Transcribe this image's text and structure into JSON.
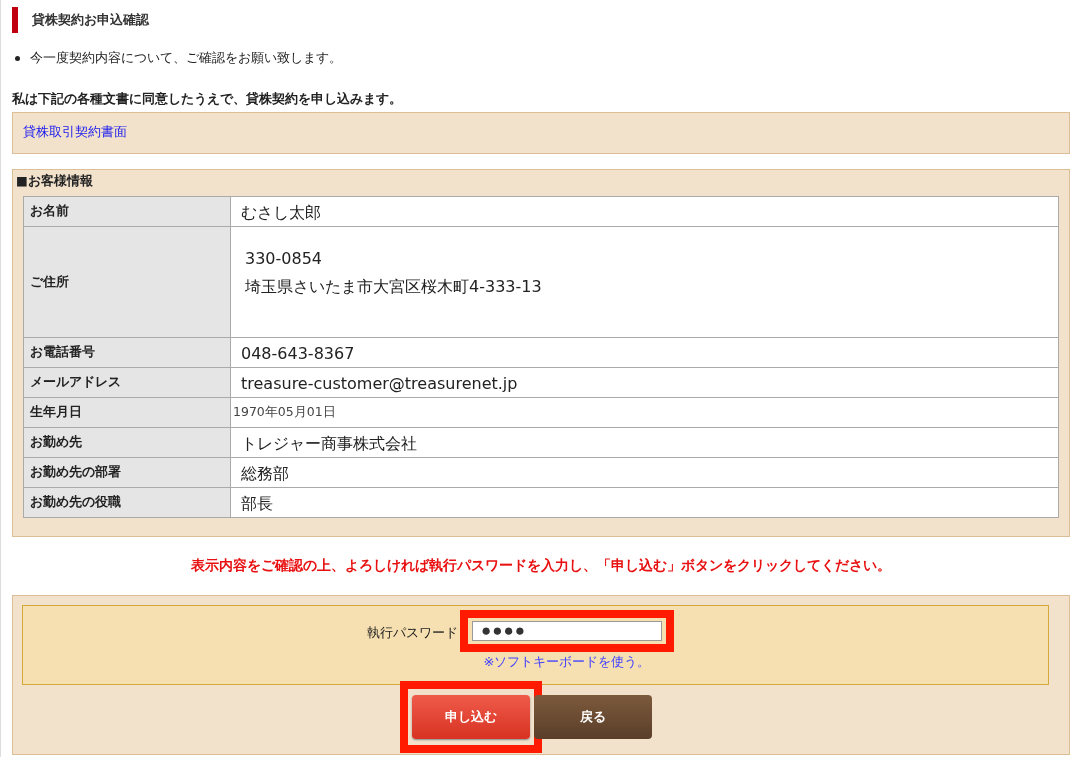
{
  "title": "貸株契約お申込確認",
  "notes": [
    "今一度契約内容について、ご確認をお願い致します。"
  ],
  "agreement": "私は下記の各種文書に同意したうえで、貸株契約を申し込みます。",
  "documents": [
    "貸株取引契約書面"
  ],
  "customer": {
    "heading": "■お客様情報",
    "rows": [
      {
        "label": "お名前",
        "lines": [
          "むさし太郎"
        ],
        "kind": "normal"
      },
      {
        "label": "ご住所",
        "lines": [
          "330-0854",
          "埼玉県さいたま市大宮区桜木町4-333-13"
        ],
        "kind": "tall"
      },
      {
        "label": "お電話番号",
        "lines": [
          "048-643-8367"
        ],
        "kind": "normal"
      },
      {
        "label": "メールアドレス",
        "lines": [
          "treasure-customer@treasurenet.jp"
        ],
        "kind": "normal"
      },
      {
        "label": "生年月日",
        "lines": [
          "1970年05月01日"
        ],
        "kind": "small"
      },
      {
        "label": "お勤め先",
        "lines": [
          "トレジャー商事株式会社"
        ],
        "kind": "normal"
      },
      {
        "label": "お勤め先の部署",
        "lines": [
          "総務部"
        ],
        "kind": "normal"
      },
      {
        "label": "お勤め先の役職",
        "lines": [
          "部長"
        ],
        "kind": "normal"
      }
    ]
  },
  "instruction": "表示内容をご確認の上、よろしければ執行パスワードを入力し、「申し込む」ボタンをクリックしてください。",
  "password": {
    "label": "執行パスワード",
    "value": "●●●●",
    "link": "※ソフトキーボードを使う。"
  },
  "buttons": [
    {
      "label": "申し込む",
      "kind": "primary"
    },
    {
      "label": "戻る",
      "kind": "secondary"
    }
  ]
}
